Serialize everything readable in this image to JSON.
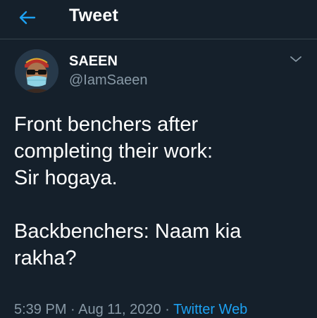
{
  "header": {
    "title": "Tweet"
  },
  "author": {
    "name": "SAEEN",
    "handle": "@IamSaeen"
  },
  "tweet": {
    "lines": [
      "Front benchers after",
      "completing their work:",
      "Sir hogaya.",
      "",
      "Backbenchers: Naam kia",
      "rakha?"
    ]
  },
  "meta": {
    "time": "5:39 PM",
    "separator1": " · ",
    "date": "Aug 11, 2020",
    "separator2": " · ",
    "source": "Twitter Web"
  },
  "colors": {
    "background": "#15202b",
    "accent": "#1da1f2",
    "secondary_text": "#8899a6",
    "divider": "#38444d"
  },
  "icons": {
    "back": "arrow-left-icon",
    "menu": "chevron-down-icon"
  }
}
